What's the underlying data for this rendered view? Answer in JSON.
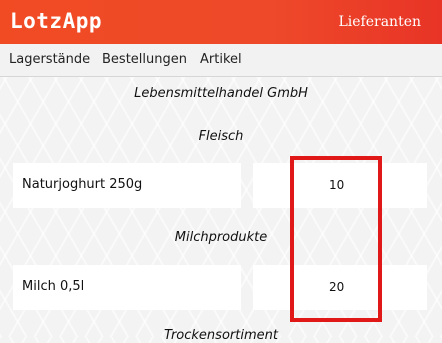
{
  "header": {
    "brand": "LotzApp",
    "link": "Lieferanten"
  },
  "nav": {
    "items": [
      "Lagerstände",
      "Bestellungen",
      "Artikel"
    ]
  },
  "supplier": "Lebensmittelhandel GmbH",
  "groups": [
    {
      "title": "Fleisch",
      "items": [
        {
          "name": "Naturjoghurt 250g",
          "qty": "10"
        }
      ]
    },
    {
      "title": "Milchprodukte",
      "items": [
        {
          "name": "Milch 0,5l",
          "qty": "20"
        }
      ]
    },
    {
      "title": "Trockensortiment",
      "items": []
    }
  ],
  "colors": {
    "accent": "#ee4a2a",
    "highlight": "#e01818"
  }
}
